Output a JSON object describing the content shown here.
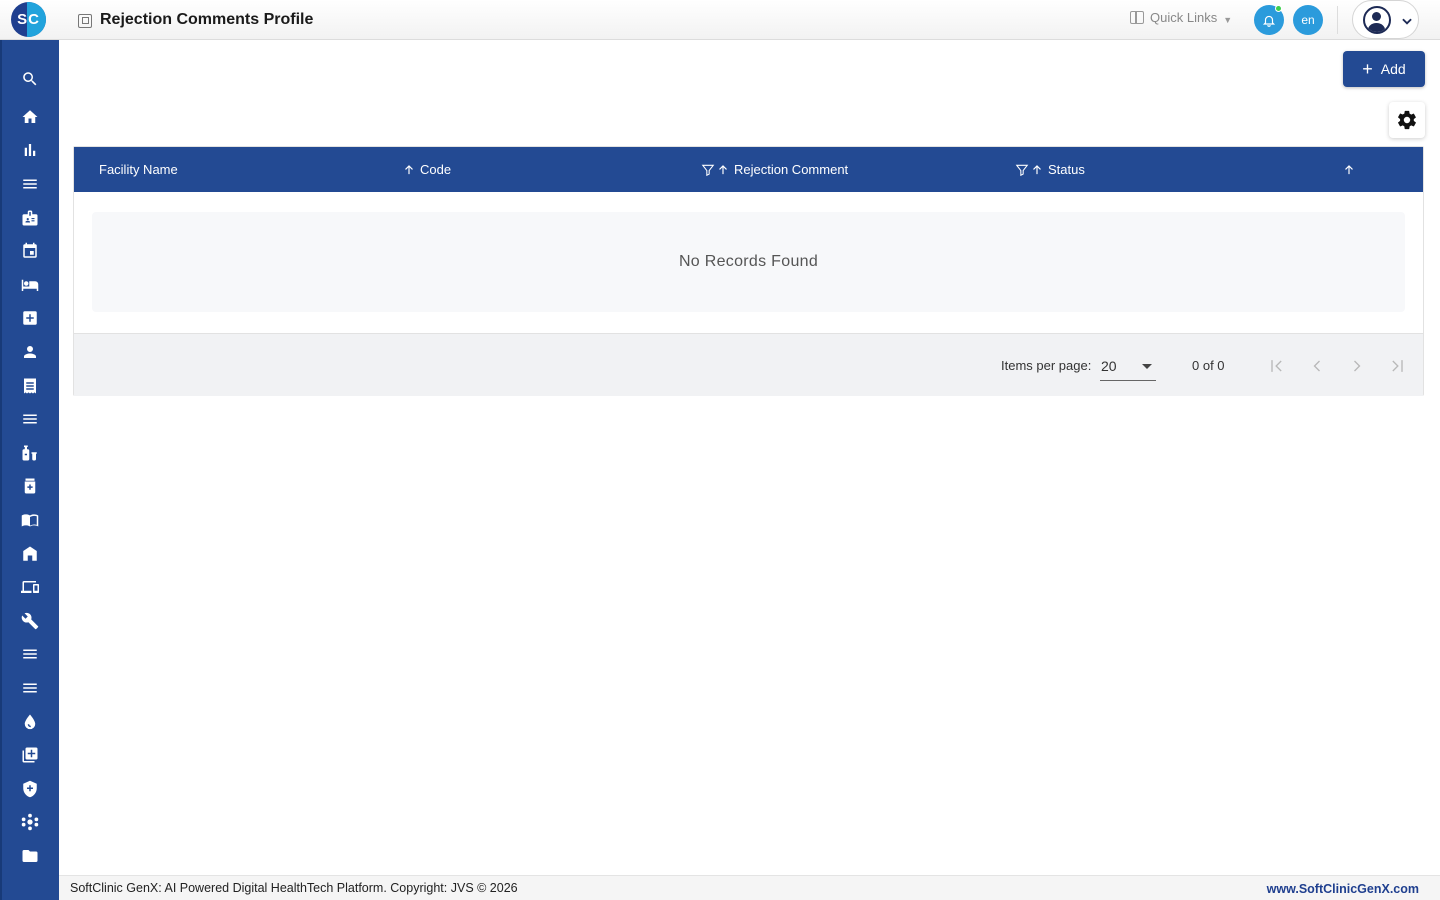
{
  "app": {
    "logo_text": "SC",
    "brand_colors": {
      "primary": "#234a93",
      "accent": "#2b9bdc"
    }
  },
  "header": {
    "page_title": "Rejection Comments Profile",
    "quick_links": "Quick Links",
    "language": "en",
    "notification_badge": "online",
    "user_menu_icon": "user-avatar-icon"
  },
  "sidebar": {
    "items": [
      {
        "icon": "search-icon"
      },
      {
        "icon": "home-icon"
      },
      {
        "icon": "bar-chart-icon"
      },
      {
        "icon": "menu-icon"
      },
      {
        "icon": "id-badge-icon"
      },
      {
        "icon": "calendar-icon"
      },
      {
        "icon": "bed-icon"
      },
      {
        "icon": "medical-plus-icon"
      },
      {
        "icon": "person-icon"
      },
      {
        "icon": "receipt-icon"
      },
      {
        "icon": "menu-icon"
      },
      {
        "icon": "pharmacy-icon"
      },
      {
        "icon": "medicine-box-icon"
      },
      {
        "icon": "book-icon"
      },
      {
        "icon": "store-icon"
      },
      {
        "icon": "devices-icon"
      },
      {
        "icon": "wrench-icon"
      },
      {
        "icon": "menu-icon"
      },
      {
        "icon": "menu-icon"
      },
      {
        "icon": "drop-icon"
      },
      {
        "icon": "add-library-icon"
      },
      {
        "icon": "shield-plus-icon"
      },
      {
        "icon": "hub-icon"
      },
      {
        "icon": "folder-icon"
      }
    ]
  },
  "toolbar": {
    "add_label": "Add"
  },
  "table": {
    "columns": [
      {
        "label": "Facility Name"
      },
      {
        "label": "Code"
      },
      {
        "label": "Rejection Comment"
      },
      {
        "label": "Status"
      }
    ],
    "empty_message": "No Records Found"
  },
  "pagination": {
    "items_per_page_label": "Items per page:",
    "items_per_page_value": "20",
    "range_label": "0 of 0"
  },
  "footer": {
    "copyright": "SoftClinic GenX: AI Powered Digital HealthTech Platform. Copyright: JVS © 2026",
    "website": "www.SoftClinicGenX.com"
  }
}
